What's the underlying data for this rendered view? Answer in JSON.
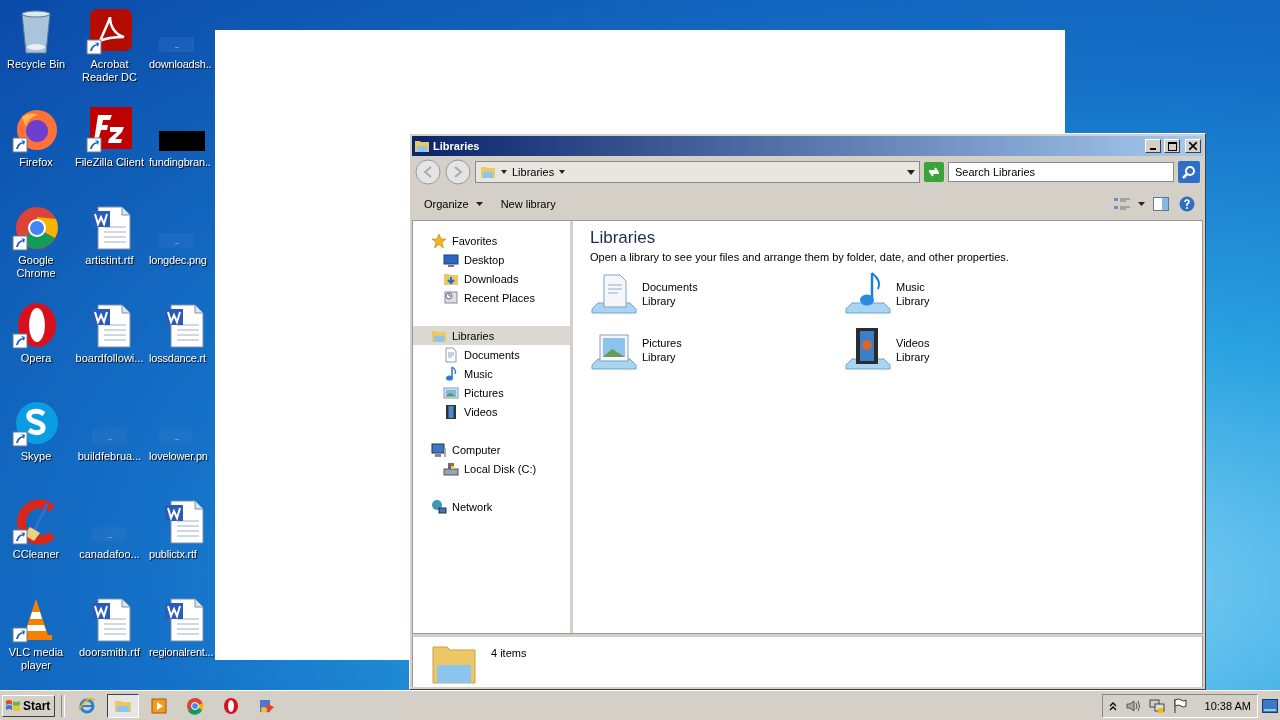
{
  "desktop_icons": [
    {
      "label": "Recycle Bin",
      "kind": "recycle",
      "shortcut": false
    },
    {
      "label": "Acrobat Reader DC",
      "kind": "acrobat",
      "shortcut": true
    },
    {
      "label": "downloadsh..",
      "kind": "blank",
      "shortcut": false
    },
    {
      "label": "Firefox",
      "kind": "firefox",
      "shortcut": true
    },
    {
      "label": "FileZilla Client",
      "kind": "filezilla",
      "shortcut": true
    },
    {
      "label": "fundingbran..",
      "kind": "dark",
      "shortcut": false
    },
    {
      "label": "Google Chrome",
      "kind": "chrome",
      "shortcut": true
    },
    {
      "label": "artistint.rtf",
      "kind": "word",
      "shortcut": false
    },
    {
      "label": "longdec.png",
      "kind": "blank",
      "shortcut": false
    },
    {
      "label": "Opera",
      "kind": "opera",
      "shortcut": true
    },
    {
      "label": "boardfollowi...",
      "kind": "word",
      "shortcut": false
    },
    {
      "label": "lossdance.rt",
      "kind": "word",
      "shortcut": false
    },
    {
      "label": "Skype",
      "kind": "skype",
      "shortcut": true
    },
    {
      "label": "buildfebrua...",
      "kind": "blank",
      "shortcut": false
    },
    {
      "label": "lovelower.pn",
      "kind": "blank",
      "shortcut": false
    },
    {
      "label": "CCleaner",
      "kind": "ccleaner",
      "shortcut": true
    },
    {
      "label": "canadafoo...",
      "kind": "blank",
      "shortcut": false
    },
    {
      "label": "publictx.rtf",
      "kind": "word",
      "shortcut": false
    },
    {
      "label": "VLC media player",
      "kind": "vlc",
      "shortcut": true
    },
    {
      "label": "doorsmith.rtf",
      "kind": "word",
      "shortcut": false
    },
    {
      "label": "regionalrent...",
      "kind": "word",
      "shortcut": false
    }
  ],
  "explorer": {
    "title": "Libraries",
    "address": "Libraries",
    "search": {
      "placeholder": "Search Libraries"
    },
    "commands": [
      "Organize",
      "New library"
    ],
    "nav": [
      {
        "label": "Favorites",
        "kind": "star",
        "selected": false,
        "children": [
          {
            "label": "Desktop",
            "kind": "desktop",
            "selected": false
          },
          {
            "label": "Downloads",
            "kind": "downloads",
            "selected": false
          },
          {
            "label": "Recent Places",
            "kind": "recent",
            "selected": false
          }
        ]
      },
      {
        "label": "Libraries",
        "kind": "library",
        "selected": true,
        "children": [
          {
            "label": "Documents",
            "kind": "documents",
            "selected": false
          },
          {
            "label": "Music",
            "kind": "music",
            "selected": false
          },
          {
            "label": "Pictures",
            "kind": "pictures",
            "selected": false
          },
          {
            "label": "Videos",
            "kind": "videos",
            "selected": false
          }
        ]
      },
      {
        "label": "Computer",
        "kind": "computer",
        "selected": false,
        "children": [
          {
            "label": "Local Disk (C:)",
            "kind": "disk",
            "selected": false
          }
        ]
      },
      {
        "label": "Network",
        "kind": "network",
        "selected": false
      }
    ],
    "heading": "Libraries",
    "description": "Open a library to see your files and arrange them by folder, date, and other properties.",
    "libraries": [
      {
        "name": "Documents",
        "type": "Library",
        "kind": "documents"
      },
      {
        "name": "Music",
        "type": "Library",
        "kind": "music"
      },
      {
        "name": "Pictures",
        "type": "Library",
        "kind": "pictures"
      },
      {
        "name": "Videos",
        "type": "Library",
        "kind": "videos"
      }
    ],
    "status": "4 items"
  },
  "taskbar": {
    "start": "Start",
    "apps": [
      {
        "kind": "ie",
        "selected": false
      },
      {
        "kind": "explorer",
        "selected": true
      },
      {
        "kind": "media",
        "selected": false
      },
      {
        "kind": "chrome",
        "selected": false
      },
      {
        "kind": "opera",
        "selected": false
      },
      {
        "kind": "app",
        "selected": false
      }
    ],
    "clock": "10:38 AM"
  }
}
